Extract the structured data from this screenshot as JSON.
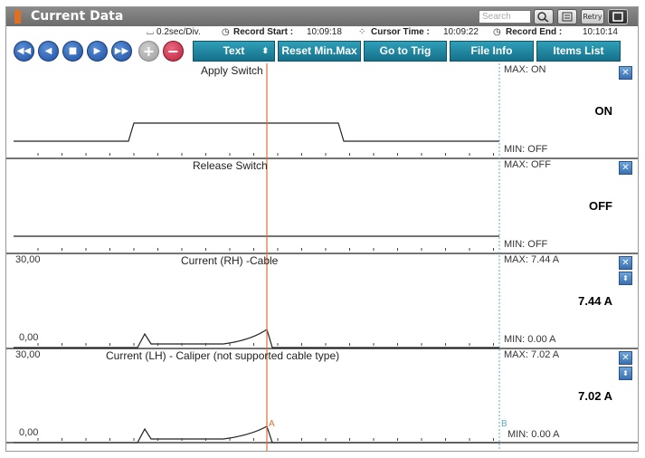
{
  "window": {
    "title": "Current Data",
    "search_placeholder": "Search",
    "retry_label": "Retry"
  },
  "info": {
    "time_div": "0.2sec/Div.",
    "record_start_label": "Record Start :",
    "record_start": "10:09:18",
    "cursor_time_label": "Cursor Time :",
    "cursor_time": "10:09:22",
    "record_end_label": "Record End :",
    "record_end": "10:10:14"
  },
  "toolbar": {
    "media_buttons": [
      "rewind-fast",
      "step-back",
      "stop",
      "play",
      "fast-forward",
      "add",
      "remove"
    ],
    "text_label": "Text",
    "reset_label": "Reset Min.Max",
    "go_trig_label": "Go to Trig",
    "file_info_label": "File Info",
    "items_list_label": "Items List"
  },
  "cursor": {
    "a_label": "A",
    "b_label": "B"
  },
  "panels": [
    {
      "title": "Apply Switch",
      "ymax": "",
      "ymin": "",
      "max_text": "MAX: ON",
      "min_text": "MIN: OFF",
      "value": "ON"
    },
    {
      "title": "Release Switch",
      "ymax": "",
      "ymin": "",
      "max_text": "MAX: OFF",
      "min_text": "MIN: OFF",
      "value": "OFF"
    },
    {
      "title": "Current (RH) -Cable",
      "ymax": "30,00",
      "ymin": "0,00",
      "max_text": "MAX:  7.44 A",
      "min_text": "MIN:  0.00 A",
      "value": "7.44 A"
    },
    {
      "title": "Current (LH) - Caliper (not supported cable type)",
      "ymax": "30,00",
      "ymin": "0,00",
      "max_text": "MAX:  7.02 A",
      "min_text": "MIN:  0.00 A",
      "value": "7.02 A"
    }
  ],
  "colors": {
    "teal": "#16708a",
    "cursor_a": "#e07030",
    "cursor_b": "#5ab0c0"
  }
}
